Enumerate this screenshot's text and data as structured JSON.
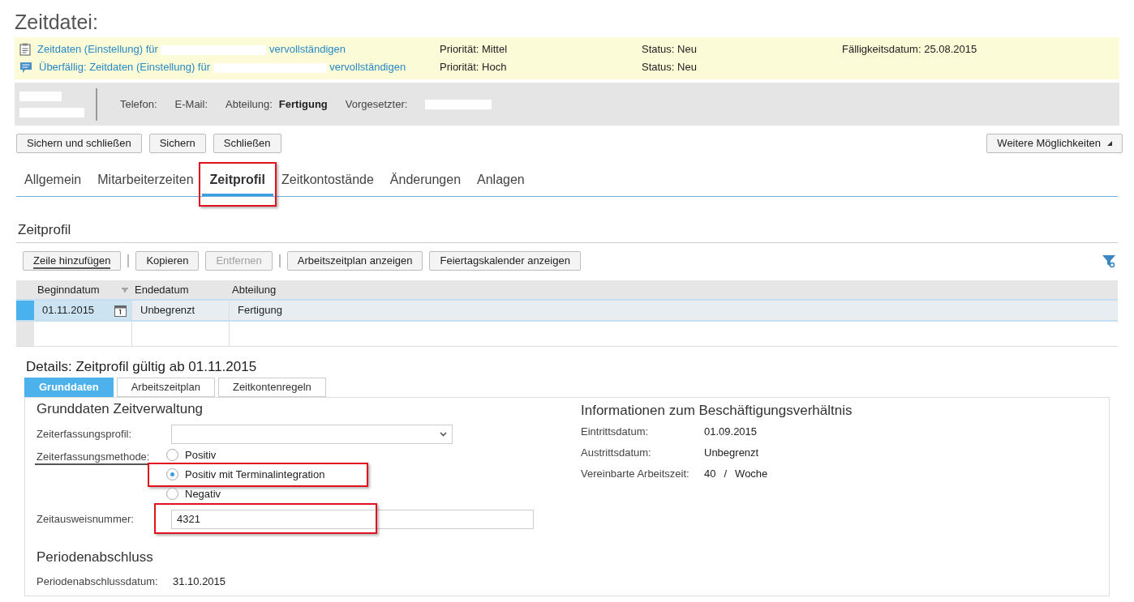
{
  "page_title": "Zeitdatei:",
  "tasks": [
    {
      "kind": "clipboard",
      "link_before": "Zeitdaten (Einstellung) für",
      "link_after": "vervollständigen",
      "priority": "Priorität: Mittel",
      "status": "Status: Neu",
      "due": "Fälligkeitsdatum: 25.08.2015"
    },
    {
      "kind": "chat",
      "link_before": "Überfällig: Zeitdaten (Einstellung) für",
      "link_after": "vervollständigen",
      "priority": "Priorität: Hoch",
      "status": "Status: Neu"
    }
  ],
  "employee": {
    "fields": [
      {
        "label": "Telefon:"
      },
      {
        "label": "E-Mail:"
      },
      {
        "label": "Abteilung:",
        "value": "Fertigung"
      },
      {
        "label": "Vorgesetzter:"
      }
    ]
  },
  "actions": [
    "Sichern und schließen",
    "Sichern",
    "Schließen"
  ],
  "more_button": "Weitere Möglichkeiten",
  "tabs": [
    {
      "label": "Allgemein",
      "selected": false
    },
    {
      "label": "Mitarbeiterzeiten",
      "selected": false
    },
    {
      "label": "Zeitprofil",
      "selected": true
    },
    {
      "label": "Zeitkontostände",
      "selected": false
    },
    {
      "label": "Änderungen",
      "selected": false
    },
    {
      "label": "Anlagen",
      "selected": false
    }
  ],
  "section_title": "Zeitprofil",
  "toolbar": [
    {
      "kind": "button",
      "label": "Zeile hinzufügen",
      "disabled": false
    },
    {
      "kind": "separator"
    },
    {
      "kind": "button",
      "label": "Kopieren",
      "disabled": false
    },
    {
      "kind": "button",
      "label": "Entfernen",
      "disabled": true
    },
    {
      "kind": "separator"
    },
    {
      "kind": "button",
      "label": "Arbeitszeitplan anzeigen",
      "disabled": false
    },
    {
      "kind": "button",
      "label": "Feiertagskalender anzeigen",
      "disabled": false
    }
  ],
  "table": {
    "columns": [
      "Beginndatum",
      "Endedatum",
      "Abteilung"
    ],
    "rows": [
      {
        "selected": true,
        "cells": [
          "01.11.2015",
          "Unbegrenzt",
          "Fertigung"
        ]
      }
    ]
  },
  "details": {
    "title": "Details: Zeitprofil gültig ab 01.11.2015",
    "tabs": [
      {
        "label": "Grunddaten",
        "selected": true
      },
      {
        "label": "Arbeitszeitplan",
        "selected": false
      },
      {
        "label": "Zeitkontenregeln",
        "selected": false
      }
    ],
    "left_title": "Grunddaten Zeitverwaltung",
    "profile_label": "Zeiterfassungsprofil:",
    "method_label": "Zeiterfassungsmethode:",
    "methods": [
      {
        "label": "Positiv",
        "selected": false
      },
      {
        "label": "Positiv mit Terminalintegration",
        "selected": true
      },
      {
        "label": "Negativ",
        "selected": false
      }
    ],
    "card_label": "Zeitausweisnummer:",
    "card_value": "4321",
    "period_title": "Periodenabschluss",
    "period_label": "Periodenabschlussdatum:",
    "period_value": "31.10.2015",
    "right_title": "Informationen zum Beschäftigungsverhältnis",
    "info": [
      {
        "label": "Eintrittsdatum:",
        "value": "01.09.2015"
      },
      {
        "label": "Austrittsdatum:",
        "value": "Unbegrenzt"
      },
      {
        "label": "Vereinbarte Arbeitszeit:",
        "value": "40",
        "unit_sep": "/",
        "unit": "Woche"
      }
    ]
  }
}
